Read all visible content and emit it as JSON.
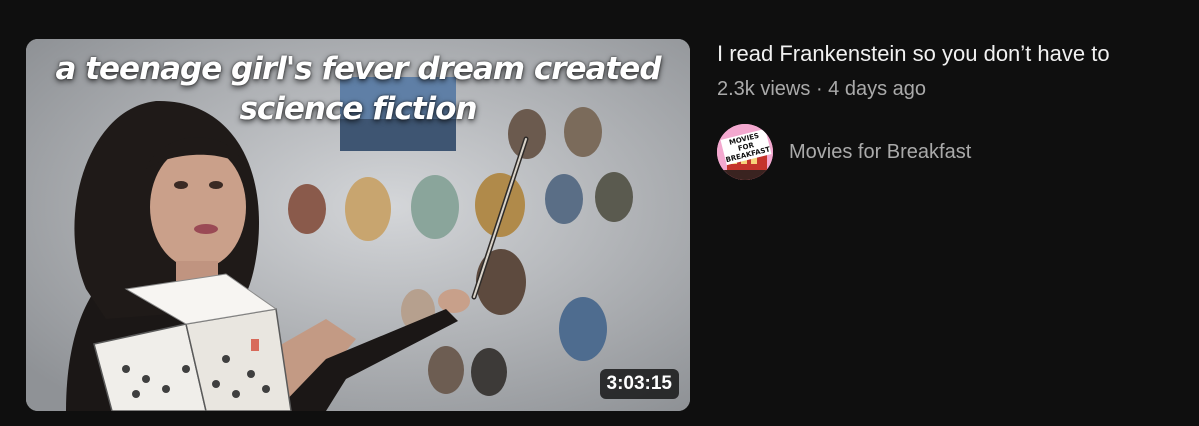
{
  "video": {
    "thumbnail": {
      "overlay_text_line1": "a teenage girl's fever dream created",
      "overlay_text_line2": "science fiction",
      "duration": "3:03:15"
    },
    "title": "I read Frankenstein so you don’t have to",
    "views": "2.3k views",
    "separator": "·",
    "age": "4 days ago"
  },
  "channel": {
    "name": "Movies for Breakfast",
    "avatar_text": "MOVIES FOR BREAKFAST"
  },
  "colors": {
    "background": "#0f0f0f",
    "title": "#f1f1f1",
    "secondary_text": "#aaaaaa",
    "avatar_bg": "#f3a8cf"
  }
}
